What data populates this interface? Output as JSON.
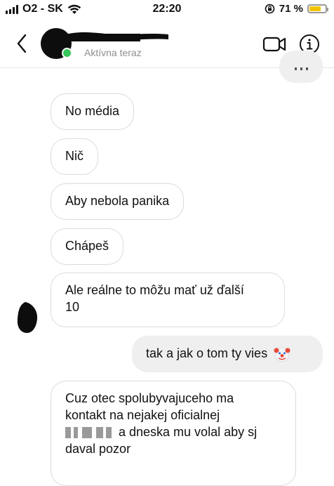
{
  "status_bar": {
    "carrier": "O2 - SK",
    "time": "22:20",
    "battery_percent": "71 %",
    "battery_level": 0.71,
    "icons": [
      "signal-icon",
      "wifi-icon",
      "orientation-lock-icon",
      "battery-icon"
    ]
  },
  "header": {
    "presence": "Aktívna teraz",
    "icons": [
      "back-chevron-icon",
      "video-call-icon",
      "info-icon"
    ],
    "online_color": "#34c759"
  },
  "messages": [
    {
      "direction": "received",
      "text": "No média"
    },
    {
      "direction": "received",
      "text": "Nič"
    },
    {
      "direction": "received",
      "text": "Aby nebola panika"
    },
    {
      "direction": "received",
      "text": "Chápeš"
    },
    {
      "direction": "received",
      "lines": [
        "Ale reálne to môžu mať už ďalší",
        "10"
      ]
    },
    {
      "direction": "sent",
      "text": "tak a jak o tom ty vies",
      "emoji": "clown-face-icon"
    },
    {
      "direction": "received",
      "lines": [
        "Cuz otec spolubyvajuceho ma",
        "kontakt na nejakej oficialnej",
        "a dneska mu volal aby sj",
        "daval pozor"
      ]
    }
  ],
  "colors": {
    "sent_bubble": "#efefef",
    "received_border": "#dbdbdb",
    "battery_fill": "#f2c400"
  }
}
